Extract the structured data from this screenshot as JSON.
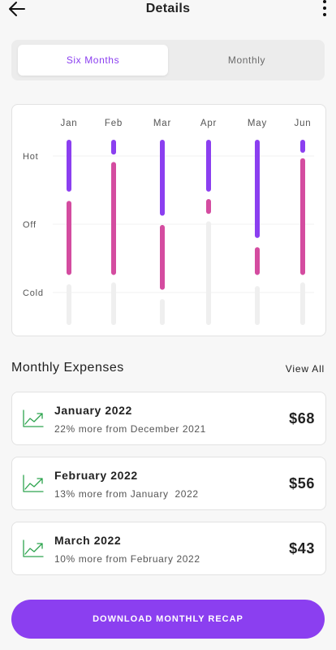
{
  "header": {
    "title": "Details"
  },
  "tabs": [
    {
      "label": "Six Months",
      "active": true
    },
    {
      "label": "Monthly",
      "active": false
    }
  ],
  "chart_data": {
    "type": "range-bar",
    "categories": [
      "Jan",
      "Feb",
      "Mar",
      "Apr",
      "May",
      "Jun"
    ],
    "y_levels": [
      "Hot",
      "Off",
      "Cold"
    ],
    "colors": {
      "hot": "#8b3ff0",
      "off": "#d44ca0",
      "cold": "#efefef"
    },
    "series": [
      {
        "segments": [
          {
            "kind": "hot",
            "from": 0.0,
            "to": 0.28
          },
          {
            "kind": "off",
            "from": 0.33,
            "to": 0.73
          },
          {
            "kind": "cold",
            "from": 0.78,
            "to": 1.0
          }
        ]
      },
      {
        "segments": [
          {
            "kind": "hot",
            "from": 0.0,
            "to": 0.08
          },
          {
            "kind": "off",
            "from": 0.12,
            "to": 0.73
          },
          {
            "kind": "cold",
            "from": 0.77,
            "to": 1.0
          }
        ]
      },
      {
        "segments": [
          {
            "kind": "hot",
            "from": 0.0,
            "to": 0.41
          },
          {
            "kind": "off",
            "from": 0.46,
            "to": 0.81
          },
          {
            "kind": "cold",
            "from": 0.86,
            "to": 1.0
          }
        ]
      },
      {
        "segments": [
          {
            "kind": "hot",
            "from": 0.0,
            "to": 0.28
          },
          {
            "kind": "off",
            "from": 0.32,
            "to": 0.4
          },
          {
            "kind": "cold",
            "from": 0.44,
            "to": 1.0
          }
        ]
      },
      {
        "segments": [
          {
            "kind": "hot",
            "from": 0.0,
            "to": 0.53
          },
          {
            "kind": "off",
            "from": 0.58,
            "to": 0.73
          },
          {
            "kind": "cold",
            "from": 0.79,
            "to": 1.0
          }
        ]
      },
      {
        "segments": [
          {
            "kind": "hot",
            "from": 0.0,
            "to": 0.07
          },
          {
            "kind": "off",
            "from": 0.1,
            "to": 0.73
          },
          {
            "kind": "cold",
            "from": 0.77,
            "to": 1.0
          }
        ]
      }
    ]
  },
  "expenses": {
    "title": "Monthly Expenses",
    "view_all": "View All",
    "items": [
      {
        "month": "January 2022",
        "subtitle": "22% more from December 2021",
        "amount": "$68"
      },
      {
        "month": "February 2022",
        "subtitle": "13% more from January  2022",
        "amount": "$56"
      },
      {
        "month": "March 2022",
        "subtitle": "10% more from February 2022",
        "amount": "$43"
      }
    ]
  },
  "download_label": "DOWNLOAD MONTHLY RECAP",
  "accent_color": "#8b3ff0",
  "icons": {
    "back": "arrow-left-icon",
    "more": "more-vertical-icon",
    "trend": "trending-up-icon"
  }
}
